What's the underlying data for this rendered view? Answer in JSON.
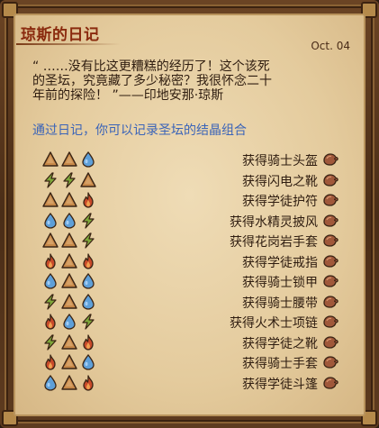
{
  "journal": {
    "title": "琼斯的日记",
    "date": "Oct. 04",
    "quote_lines": [
      "“ ……没有比这更糟糕的经历了！这个该死",
      "的圣坛，究竟藏了多少秘密？我很怀念二十",
      "年前的探险！ ”——印地安那·琼斯"
    ],
    "hint": "通过日记，你可以记录圣坛的结晶组合"
  },
  "gem_types": {
    "earth": {
      "icon": "earth-triangle-icon",
      "color": "#c98a4a"
    },
    "lightning": {
      "icon": "lightning-bolt-icon",
      "color": "#7fa83a"
    },
    "water": {
      "icon": "water-drop-icon",
      "color": "#5e9fd8"
    },
    "fire": {
      "icon": "fire-flame-icon",
      "color": "#c94a2a"
    }
  },
  "recipes": [
    {
      "gems": [
        "earth",
        "earth",
        "water"
      ],
      "label": "获得骑士头盔"
    },
    {
      "gems": [
        "lightning",
        "lightning",
        "earth"
      ],
      "label": "获得闪电之靴"
    },
    {
      "gems": [
        "earth",
        "earth",
        "fire"
      ],
      "label": "获得学徒护符"
    },
    {
      "gems": [
        "water",
        "water",
        "lightning"
      ],
      "label": "获得水精灵披风"
    },
    {
      "gems": [
        "earth",
        "earth",
        "lightning"
      ],
      "label": "获得花岗岩手套"
    },
    {
      "gems": [
        "fire",
        "earth",
        "fire"
      ],
      "label": "获得学徒戒指"
    },
    {
      "gems": [
        "water",
        "earth",
        "water"
      ],
      "label": "获得骑士锁甲"
    },
    {
      "gems": [
        "lightning",
        "earth",
        "water"
      ],
      "label": "获得骑士腰带"
    },
    {
      "gems": [
        "fire",
        "water",
        "lightning"
      ],
      "label": "获得火术士项链"
    },
    {
      "gems": [
        "lightning",
        "earth",
        "fire"
      ],
      "label": "获得学徒之靴"
    },
    {
      "gems": [
        "fire",
        "earth",
        "water"
      ],
      "label": "获得骑士手套"
    },
    {
      "gems": [
        "water",
        "earth",
        "fire"
      ],
      "label": "获得学徒斗篷"
    }
  ],
  "colors": {
    "title": "#8a2a0e",
    "hint": "#3b64b8",
    "paper": "#e8d2a8"
  }
}
